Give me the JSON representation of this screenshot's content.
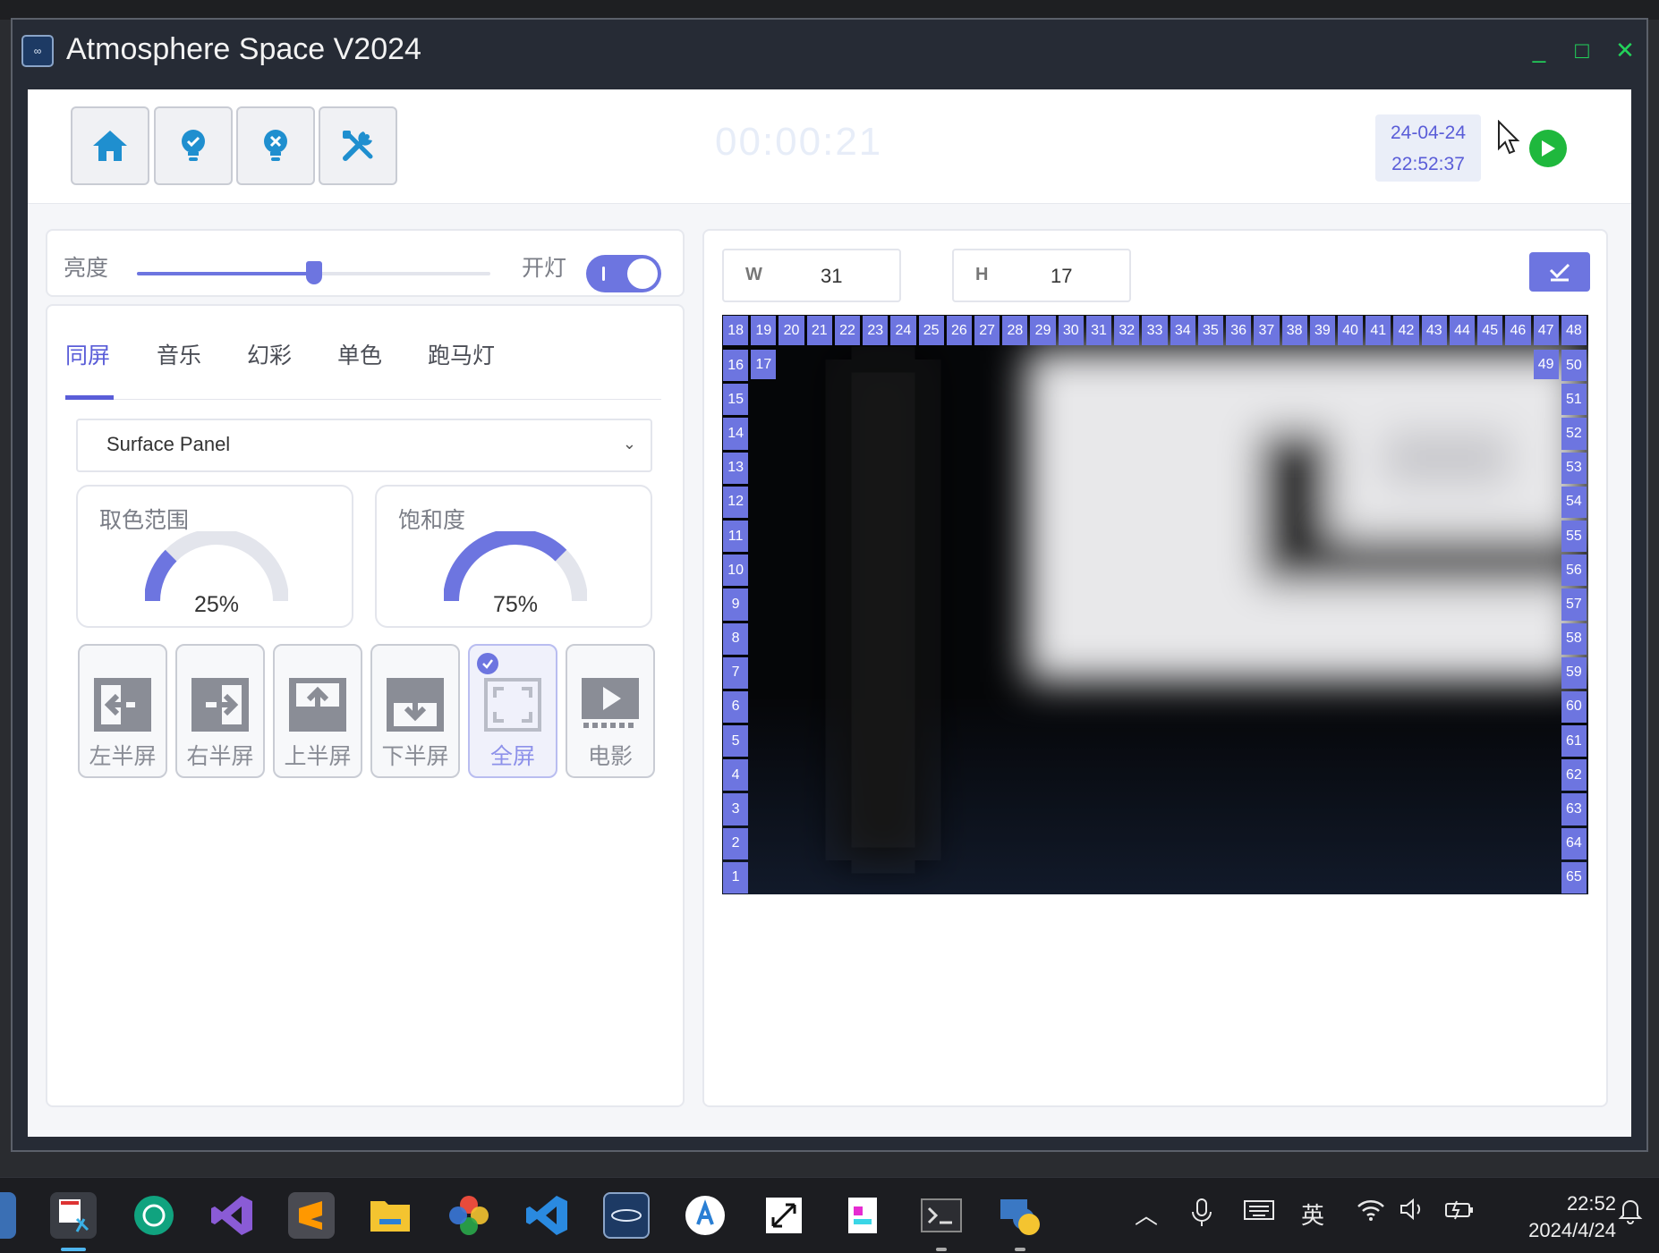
{
  "window": {
    "title": "Atmosphere Space V2024",
    "logo_text": "∞",
    "minimize": "_",
    "maximize": "□",
    "close": "✕"
  },
  "toolbar": {
    "buttons": [
      "home-icon",
      "bulb-check-icon",
      "bulb-off-icon",
      "tools-icon"
    ],
    "clock_ghost": "00:00:21",
    "date": "24-04-24",
    "time": "22:52:37"
  },
  "brightness": {
    "label": "亮度",
    "value_percent": 50,
    "light_label": "开灯",
    "light_on": true
  },
  "tabs": [
    "同屏",
    "音乐",
    "幻彩",
    "单色",
    "跑马灯"
  ],
  "active_tab": "同屏",
  "device_select": {
    "value": "Surface Panel"
  },
  "gauges": [
    {
      "title": "取色范围",
      "value": "25%",
      "fraction": 0.25
    },
    {
      "title": "饱和度",
      "value": "75%",
      "fraction": 0.75
    }
  ],
  "modes": [
    {
      "label": "左半屏",
      "icon": "left-half-icon"
    },
    {
      "label": "右半屏",
      "icon": "right-half-icon"
    },
    {
      "label": "上半屏",
      "icon": "top-half-icon"
    },
    {
      "label": "下半屏",
      "icon": "bottom-half-icon"
    },
    {
      "label": "全屏",
      "icon": "fullscreen-icon",
      "selected": true
    },
    {
      "label": "电影",
      "icon": "movie-icon"
    }
  ],
  "led_config": {
    "w_label": "W",
    "w_value": "31",
    "h_label": "H",
    "h_value": "17",
    "left_leds": [
      "16",
      "15",
      "14",
      "13",
      "12",
      "11",
      "10",
      "9",
      "8",
      "7",
      "6",
      "5",
      "4",
      "3",
      "2",
      "1"
    ],
    "top_leds": [
      "18",
      "19",
      "20",
      "21",
      "22",
      "23",
      "24",
      "25",
      "26",
      "27",
      "28",
      "29",
      "30",
      "31",
      "32",
      "33",
      "34",
      "35",
      "36",
      "37",
      "38",
      "39",
      "40",
      "41",
      "42",
      "43",
      "44",
      "45",
      "46",
      "47",
      "48"
    ],
    "right_leds": [
      "50",
      "51",
      "52",
      "53",
      "54",
      "55",
      "56",
      "57",
      "58",
      "59",
      "60",
      "61",
      "62",
      "63",
      "64",
      "65"
    ],
    "corner_left": "17",
    "corner_right": "49"
  },
  "taskbar": {
    "ime": "英",
    "time": "22:52",
    "date": "2024/4/24"
  },
  "colors": {
    "accent": "#6d75e0",
    "play": "#1fb83d",
    "window_controls": "#22d35a"
  }
}
